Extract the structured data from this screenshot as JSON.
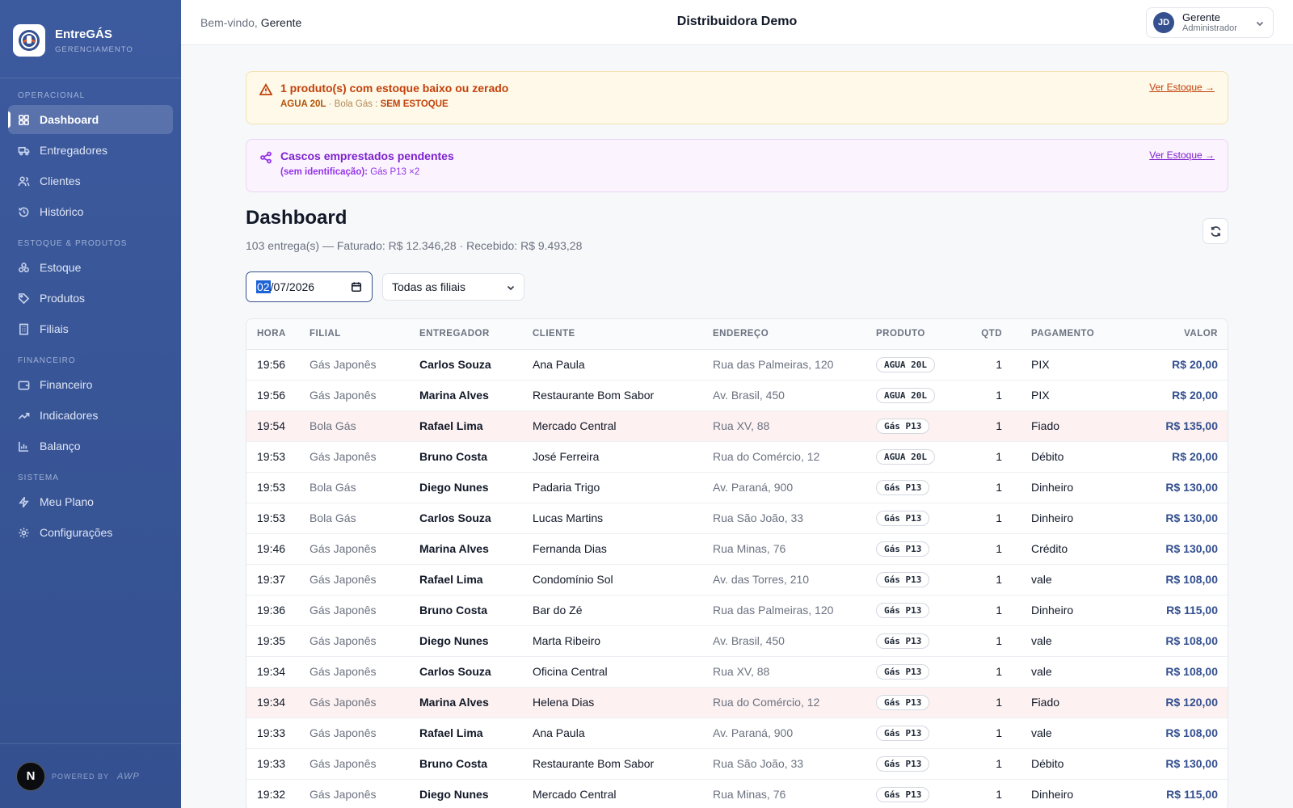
{
  "brand": {
    "name": "EntreGÁS",
    "sub": "GERENCIAMENTO"
  },
  "nav": {
    "sections": [
      {
        "title": "OPERACIONAL",
        "items": [
          {
            "label": "Dashboard",
            "icon": "grid-icon",
            "active": true
          },
          {
            "label": "Entregadores",
            "icon": "truck-icon"
          },
          {
            "label": "Clientes",
            "icon": "users-icon"
          },
          {
            "label": "Histórico",
            "icon": "history-icon"
          }
        ]
      },
      {
        "title": "ESTOQUE & PRODUTOS",
        "items": [
          {
            "label": "Estoque",
            "icon": "boxes-icon"
          },
          {
            "label": "Produtos",
            "icon": "tag-icon"
          },
          {
            "label": "Filiais",
            "icon": "building-icon"
          }
        ]
      },
      {
        "title": "FINANCEIRO",
        "items": [
          {
            "label": "Financeiro",
            "icon": "wallet-icon"
          },
          {
            "label": "Indicadores",
            "icon": "trend-icon"
          },
          {
            "label": "Balanço",
            "icon": "bar-chart-icon"
          }
        ]
      },
      {
        "title": "SISTEMA",
        "items": [
          {
            "label": "Meu Plano",
            "icon": "bolt-icon"
          },
          {
            "label": "Configurações",
            "icon": "gear-icon"
          }
        ]
      }
    ]
  },
  "footer": {
    "badge": "N",
    "powered": "POWERED BY",
    "logo": "AWP"
  },
  "topbar": {
    "welcome": "Bem-vindo,",
    "welcome_name": "Gerente",
    "company": "Distribuidora Demo",
    "user_initials": "JD",
    "user_name": "Gerente",
    "user_role": "Administrador"
  },
  "alerts": {
    "stock": {
      "title": "1 produto(s) com estoque baixo ou zerado",
      "product": "AGUA 20L",
      "branch": "· Bola Gás :",
      "status": "SEM ESTOQUE",
      "link": "Ver Estoque →"
    },
    "casks": {
      "title": "Cascos emprestados pendentes",
      "label": "(sem identificação):",
      "detail": "Gás P13 ×2",
      "link": "Ver Estoque →"
    }
  },
  "dashboard": {
    "title": "Dashboard",
    "summary": "103 entrega(s) — Faturado: R$ 12.346,28 · Recebido: R$ 9.493,28",
    "date_day": "02",
    "date_rest": "/07/2026",
    "branch_filter": "Todas as filiais"
  },
  "table": {
    "headers": [
      "HORA",
      "FILIAL",
      "ENTREGADOR",
      "CLIENTE",
      "ENDEREÇO",
      "PRODUTO",
      "QTD",
      "PAGAMENTO",
      "VALOR"
    ],
    "rows": [
      [
        "19:56",
        "Gás Japonês",
        "Carlos Souza",
        "Ana Paula",
        "Rua das Palmeiras, 120",
        "AGUA 20L",
        "1",
        "PIX",
        "R$ 20,00"
      ],
      [
        "19:56",
        "Gás Japonês",
        "Marina Alves",
        "Restaurante Bom Sabor",
        "Av. Brasil, 450",
        "AGUA 20L",
        "1",
        "PIX",
        "R$ 20,00"
      ],
      [
        "19:54",
        "Bola Gás",
        "Rafael Lima",
        "Mercado Central",
        "Rua XV, 88",
        "Gás P13",
        "1",
        "Fiado",
        "R$ 135,00"
      ],
      [
        "19:53",
        "Gás Japonês",
        "Bruno Costa",
        "José Ferreira",
        "Rua do Comércio, 12",
        "AGUA 20L",
        "1",
        "Débito",
        "R$ 20,00"
      ],
      [
        "19:53",
        "Bola Gás",
        "Diego Nunes",
        "Padaria Trigo",
        "Av. Paraná, 900",
        "Gás P13",
        "1",
        "Dinheiro",
        "R$ 130,00"
      ],
      [
        "19:53",
        "Bola Gás",
        "Carlos Souza",
        "Lucas Martins",
        "Rua São João, 33",
        "Gás P13",
        "1",
        "Dinheiro",
        "R$ 130,00"
      ],
      [
        "19:46",
        "Gás Japonês",
        "Marina Alves",
        "Fernanda Dias",
        "Rua Minas, 76",
        "Gás P13",
        "1",
        "Crédito",
        "R$ 130,00"
      ],
      [
        "19:37",
        "Gás Japonês",
        "Rafael Lima",
        "Condomínio Sol",
        "Av. das Torres, 210",
        "Gás P13",
        "1",
        "vale",
        "R$ 108,00"
      ],
      [
        "19:36",
        "Gás Japonês",
        "Bruno Costa",
        "Bar do Zé",
        "Rua das Palmeiras, 120",
        "Gás P13",
        "1",
        "Dinheiro",
        "R$ 115,00"
      ],
      [
        "19:35",
        "Gás Japonês",
        "Diego Nunes",
        "Marta Ribeiro",
        "Av. Brasil, 450",
        "Gás P13",
        "1",
        "vale",
        "R$ 108,00"
      ],
      [
        "19:34",
        "Gás Japonês",
        "Carlos Souza",
        "Oficina Central",
        "Rua XV, 88",
        "Gás P13",
        "1",
        "vale",
        "R$ 108,00"
      ],
      [
        "19:34",
        "Gás Japonês",
        "Marina Alves",
        "Helena Dias",
        "Rua do Comércio, 12",
        "Gás P13",
        "1",
        "Fiado",
        "R$ 120,00"
      ],
      [
        "19:33",
        "Gás Japonês",
        "Rafael Lima",
        "Ana Paula",
        "Av. Paraná, 900",
        "Gás P13",
        "1",
        "vale",
        "R$ 108,00"
      ],
      [
        "19:33",
        "Gás Japonês",
        "Bruno Costa",
        "Restaurante Bom Sabor",
        "Rua São João, 33",
        "Gás P13",
        "1",
        "Débito",
        "R$ 130,00"
      ],
      [
        "19:32",
        "Gás Japonês",
        "Diego Nunes",
        "Mercado Central",
        "Rua Minas, 76",
        "Gás P13",
        "1",
        "Dinheiro",
        "R$ 115,00"
      ]
    ]
  },
  "colors": {
    "sidebar": "#3c5a9e",
    "accent": "#34508f",
    "warn": "#c2410c",
    "purple": "#7e22ce",
    "fiado_row": "#fdf1f1"
  }
}
